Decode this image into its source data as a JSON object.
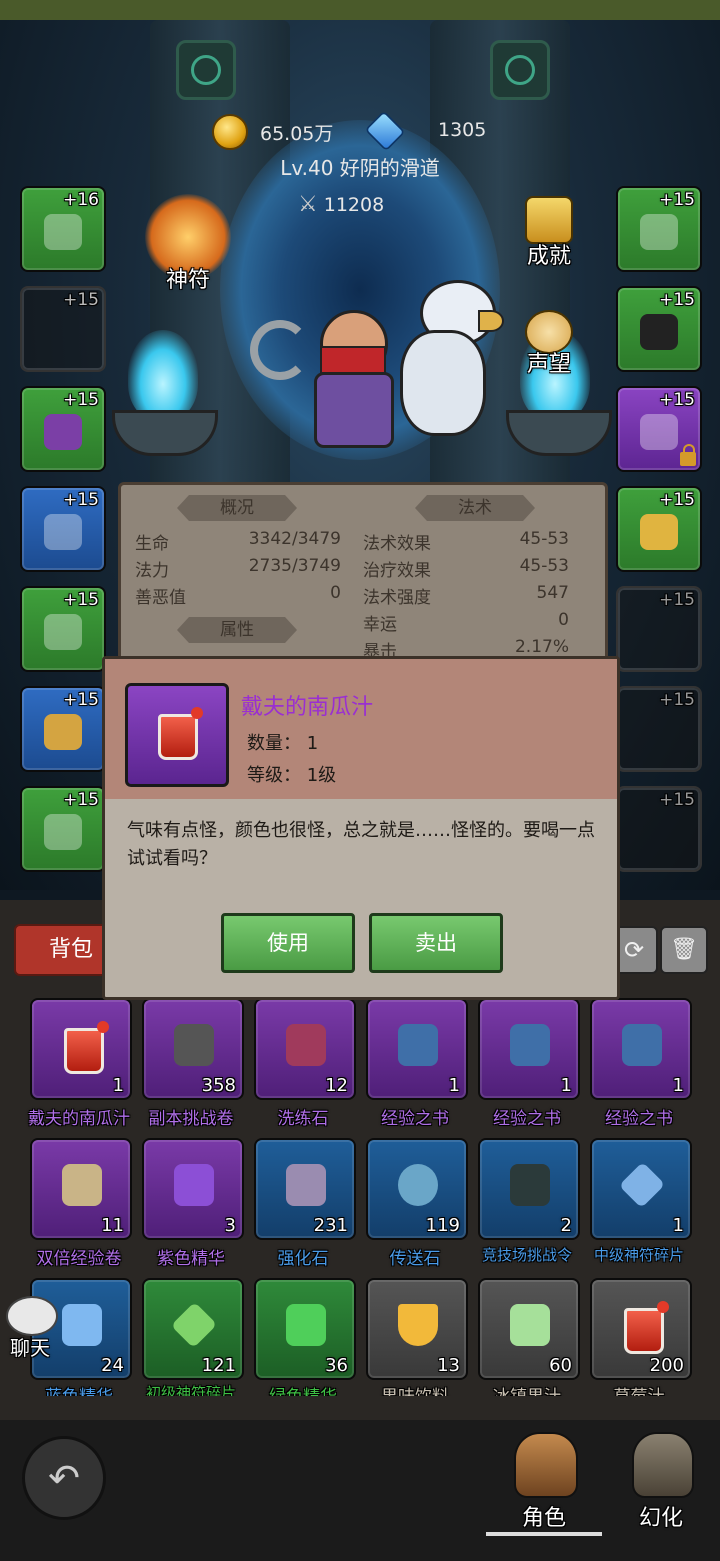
{
  "currency": {
    "gold": "65.05万",
    "diamond": "1305"
  },
  "player": {
    "level_name": "Lv.40 好阴的滑道",
    "power": "11208"
  },
  "side_buttons": {
    "rune": "神符",
    "achievement": "成就",
    "reputation": "声望"
  },
  "left_slots": [
    "+16",
    "+15",
    "+15",
    "+15",
    "+15",
    "+15",
    "+15"
  ],
  "right_slots": [
    "+15",
    "+15",
    "+15",
    "+15",
    "+15",
    "+15",
    "+15"
  ],
  "stats": {
    "overview_title": "概况",
    "magic_title": "法术",
    "attr_title": "属性",
    "left": [
      {
        "label": "生命",
        "value": "3342/3479"
      },
      {
        "label": "法力",
        "value": "2735/3749"
      },
      {
        "label": "善恶值",
        "value": "0"
      }
    ],
    "right": [
      {
        "label": "法术效果",
        "value": "45-53"
      },
      {
        "label": "治疗效果",
        "value": "45-53"
      },
      {
        "label": "法术强度",
        "value": "547"
      },
      {
        "label": "幸运",
        "value": "0"
      },
      {
        "label": "暴击",
        "value": "2.17%"
      }
    ]
  },
  "popup": {
    "item_name": "戴夫的南瓜汁",
    "quantity": "数量： 1",
    "level": "等级： 1级",
    "description": "气味有点怪，颜色也很怪，总之就是……怪怪的。要喝一点试试看吗？",
    "use_label": "使用",
    "sell_label": "卖出"
  },
  "inventory": {
    "tab": "背包",
    "items": [
      {
        "name": "戴夫的南瓜汁",
        "count": "1",
        "rarity": "purple"
      },
      {
        "name": "副本挑战卷",
        "count": "358",
        "rarity": "purple"
      },
      {
        "name": "洗练石",
        "count": "12",
        "rarity": "purple"
      },
      {
        "name": "经验之书",
        "count": "1",
        "rarity": "purple"
      },
      {
        "name": "经验之书",
        "count": "1",
        "rarity": "purple"
      },
      {
        "name": "经验之书",
        "count": "1",
        "rarity": "purple"
      },
      {
        "name": "双倍经验卷",
        "count": "11",
        "rarity": "purple"
      },
      {
        "name": "紫色精华",
        "count": "3",
        "rarity": "purple"
      },
      {
        "name": "强化石",
        "count": "231",
        "rarity": "blue"
      },
      {
        "name": "传送石",
        "count": "119",
        "rarity": "blue"
      },
      {
        "name": "竞技场挑战令",
        "count": "2",
        "rarity": "blue"
      },
      {
        "name": "中级神符碎片",
        "count": "1",
        "rarity": "blue"
      },
      {
        "name": "蓝色精华",
        "count": "24",
        "rarity": "blue"
      },
      {
        "name": "初级神符碎片",
        "count": "121",
        "rarity": "green"
      },
      {
        "name": "绿色精华",
        "count": "36",
        "rarity": "green"
      },
      {
        "name": "果味饮料",
        "count": "13",
        "rarity": "dark"
      },
      {
        "name": "冰镇果汁",
        "count": "60",
        "rarity": "dark"
      },
      {
        "name": "草莓汁",
        "count": "200",
        "rarity": "dark"
      }
    ]
  },
  "chat_label": "聊天",
  "nav": {
    "character": "角色",
    "transform": "幻化"
  },
  "colors": {
    "purple_text": "#b06fe8",
    "blue_text": "#4a9be8",
    "green_text": "#3fbf45",
    "gray_text": "#c9c0b2"
  }
}
